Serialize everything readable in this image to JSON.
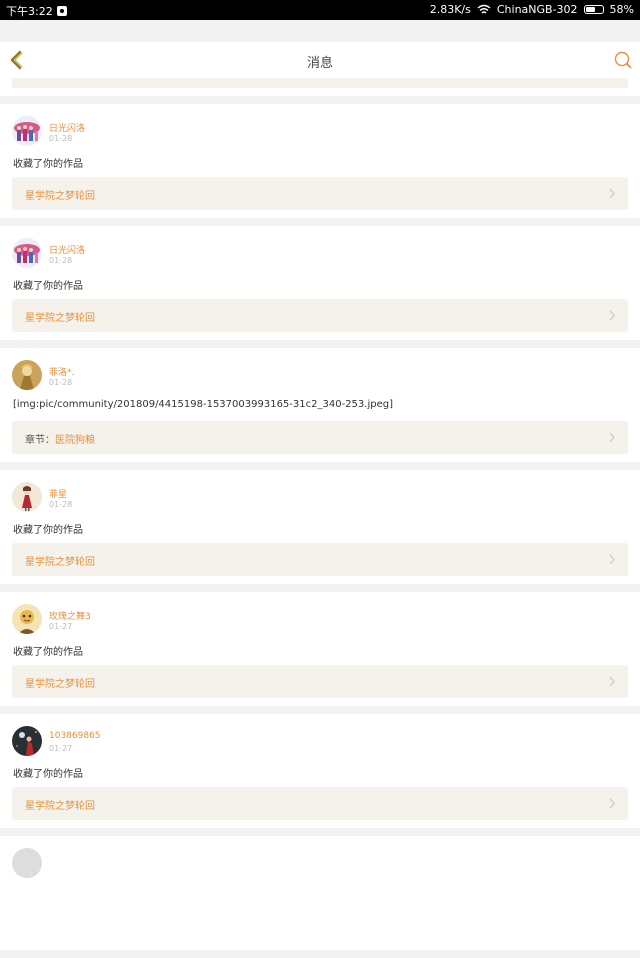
{
  "status_bar": {
    "time": "下午3:22",
    "network_speed": "2.83K/s",
    "wifi_name": "ChinaNGB-302",
    "battery_percent": "58%",
    "battery_level": 0.58
  },
  "header": {
    "title": "消息"
  },
  "messages": [
    {
      "user": "日光闪洛",
      "date": "01-28",
      "text": "收藏了你的作品",
      "link_prefix": "",
      "link_text": "星学院之梦轮回",
      "avatar": "pink-characters"
    },
    {
      "user": "日光闪洛",
      "date": "01-28",
      "text": "收藏了你的作品",
      "link_prefix": "",
      "link_text": "星学院之梦轮回",
      "avatar": "pink-characters"
    },
    {
      "user": "菲洛*.",
      "date": "01-28",
      "text": "[img:pic/community/201809/4415198-1537003993165-31c2_340-253.jpeg]",
      "link_prefix": "章节：",
      "link_text": "医院狗粮",
      "avatar": "golden-figure"
    },
    {
      "user": "菲星",
      "date": "01-28",
      "text": "收藏了你的作品",
      "link_prefix": "",
      "link_text": "星学院之梦轮回",
      "avatar": "red-dress-figure"
    },
    {
      "user": "玫瑰之舞3",
      "date": "01-27",
      "text": "收藏了你的作品",
      "link_prefix": "",
      "link_text": "星学院之梦轮回",
      "avatar": "yellow-character"
    },
    {
      "user": "103869865",
      "date": "01-27",
      "text": "收藏了你的作品",
      "link_prefix": "",
      "link_text": "星学院之梦轮回",
      "avatar": "dark-night"
    }
  ]
}
